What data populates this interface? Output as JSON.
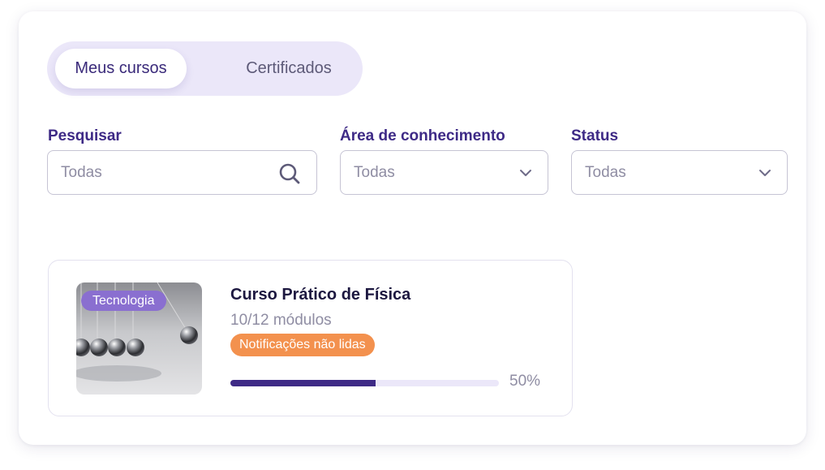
{
  "tabs": [
    {
      "label": "Meus cursos",
      "active": true
    },
    {
      "label": "Certificados",
      "active": false
    }
  ],
  "filters": {
    "search": {
      "label": "Pesquisar",
      "value": "Todas",
      "icon": "search-icon"
    },
    "area": {
      "label": "Área de conhecimento",
      "value": "Todas",
      "icon": "chevron-down-icon"
    },
    "status": {
      "label": "Status",
      "value": "Todas",
      "icon": "chevron-down-icon"
    }
  },
  "courses": [
    {
      "category": "Tecnologia",
      "title": "Curso Prático de Física",
      "modules": "10/12 módulos",
      "notification_badge": "Notificações não lidas",
      "progress_label": "50%",
      "progress_fraction": 0.54
    }
  ],
  "colors": {
    "primary": "#3e2a86",
    "tab_bg": "#ebe7f9",
    "badge_category": "#8a6fd0",
    "badge_notification": "#f3914e",
    "muted_text": "#8f8da3"
  }
}
